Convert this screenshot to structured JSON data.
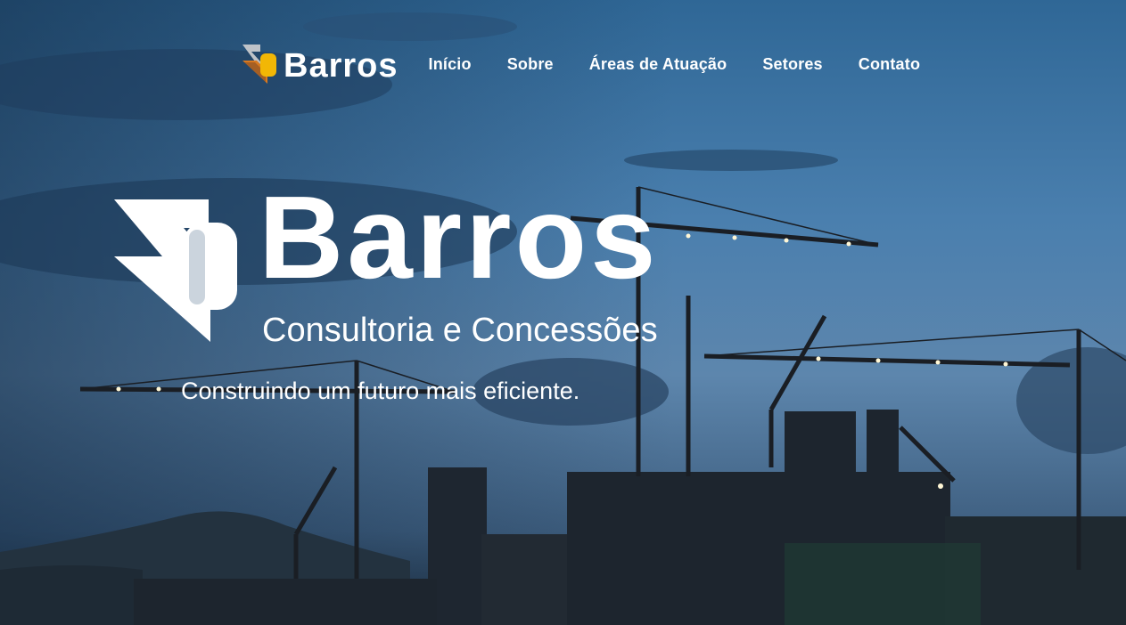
{
  "brand": {
    "name": "Barros",
    "tagline": "Consultoria e Concessões",
    "logo_colors": {
      "orange": "#d9791f",
      "yellow": "#f2b705",
      "brown": "#7a4a28",
      "gray": "#bfc3c8"
    }
  },
  "nav": {
    "items": [
      {
        "label": "Início"
      },
      {
        "label": "Sobre"
      },
      {
        "label": "Áreas de Atuação"
      },
      {
        "label": "Setores"
      },
      {
        "label": "Contato"
      }
    ]
  },
  "hero": {
    "headline": "Construindo um futuro mais eficiente."
  }
}
